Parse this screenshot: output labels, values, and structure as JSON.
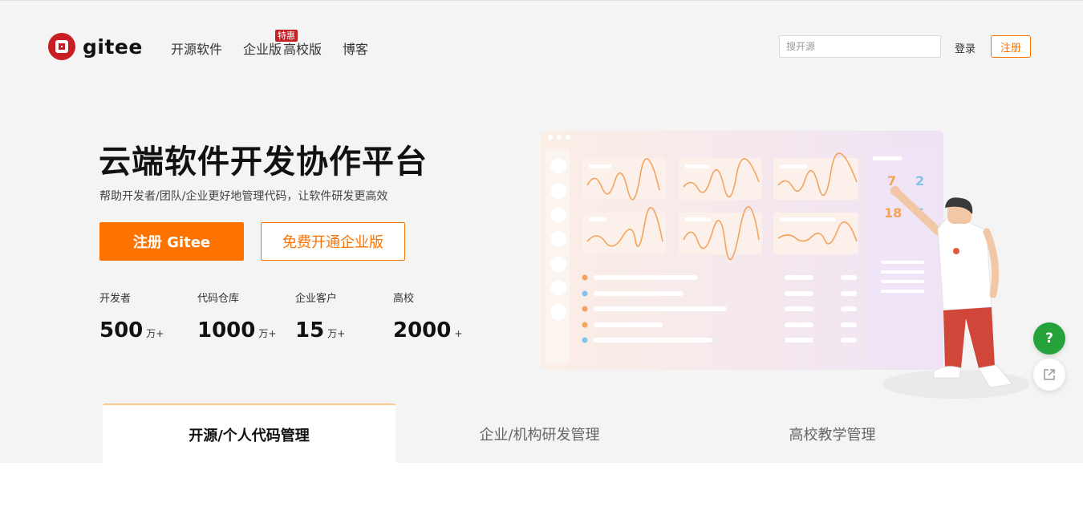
{
  "header": {
    "logo_text": "gitee",
    "nav": [
      {
        "label": "开源软件"
      },
      {
        "label": "企业版",
        "badge": "特惠"
      },
      {
        "label": "高校版"
      },
      {
        "label": "博客"
      }
    ],
    "search_placeholder": "搜开源",
    "login_label": "登录",
    "signup_label": "注册"
  },
  "hero": {
    "title": "云端软件开发协作平台",
    "subtitle": "帮助开发者/团队/企业更好地管理代码，让软件研发更高效",
    "primary_button": "注册 Gitee",
    "secondary_button": "免费开通企业版",
    "stats": [
      {
        "label": "开发者",
        "value": "500",
        "unit": "万+"
      },
      {
        "label": "代码仓库",
        "value": "1000",
        "unit": "万+"
      },
      {
        "label": "企业客户",
        "value": "15",
        "unit": "万+"
      },
      {
        "label": "高校",
        "value": "2000",
        "unit": "+"
      }
    ]
  },
  "illustration": {
    "numbers": [
      "7",
      "2",
      "18",
      "6"
    ]
  },
  "float_buttons": {
    "help_label": "?"
  },
  "tabs": [
    {
      "label": "开源/个人代码管理",
      "active": true
    },
    {
      "label": "企业/机构研发管理",
      "active": false
    },
    {
      "label": "高校教学管理",
      "active": false
    }
  ],
  "colors": {
    "brand_red": "#c71d23",
    "accent_orange": "#fe7300",
    "help_green": "#25a33a"
  }
}
